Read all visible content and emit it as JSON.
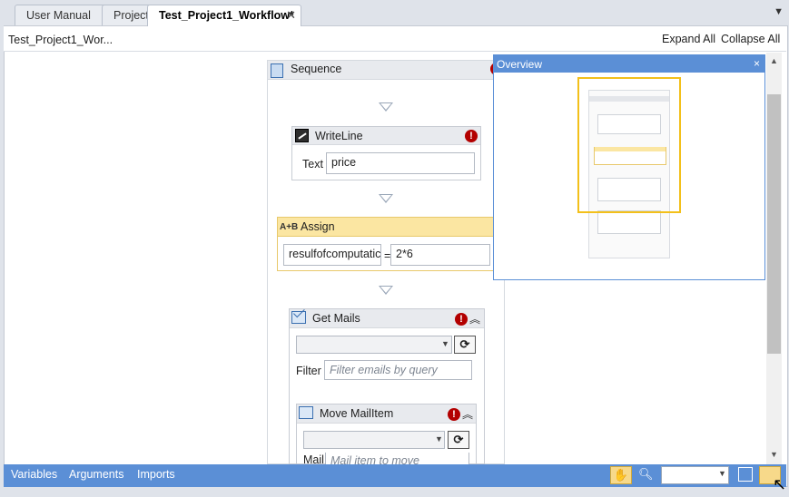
{
  "tabs": [
    {
      "label": "User Manual",
      "active": false
    },
    {
      "label": "Project",
      "active": false
    },
    {
      "label": "Test_Project1_Workflow*",
      "active": true
    }
  ],
  "header": {
    "breadcrumb": "Test_Project1_Wor...",
    "expand_all": "Expand All",
    "collapse_all": "Collapse All"
  },
  "workflow": {
    "sequence_title": "Sequence",
    "writeline": {
      "title": "WriteLine",
      "text_label": "Text",
      "text_value": "price"
    },
    "assign": {
      "title": "Assign",
      "icon_text": "A+B",
      "to_value": "resulfofcomputatic",
      "operator": "=",
      "value": "2*6"
    },
    "get_mails": {
      "title": "Get Mails",
      "filter_label": "Filter",
      "filter_placeholder": "Filter emails by query"
    },
    "move_mailitem": {
      "title": "Move MailItem",
      "mail_label": "Mail",
      "mail_placeholder": "Mail item to move"
    }
  },
  "overview": {
    "title": "Overview"
  },
  "bottom_bar": {
    "variables": "Variables",
    "arguments": "Arguments",
    "imports": "Imports",
    "zoom_value": ""
  },
  "colors": {
    "accent_blue": "#5b8fd6",
    "assign_highlight": "#fbe6a2",
    "error_red": "#b30000",
    "viewport_yellow": "#f3c01a"
  }
}
